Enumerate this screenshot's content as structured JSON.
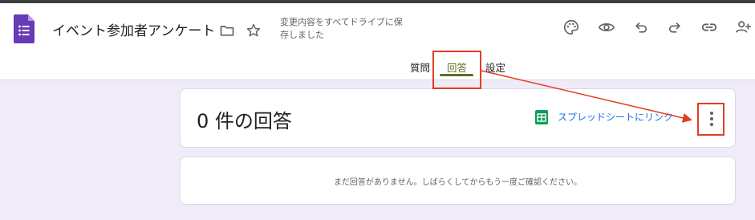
{
  "header": {
    "form_title": "イベント参加者アンケート",
    "save_status": "変更内容をすべてドライブに保存しました",
    "icons": [
      "forms-logo-icon",
      "folder-icon",
      "star-icon",
      "palette-icon",
      "eye-icon",
      "undo-icon",
      "redo-icon",
      "link-icon",
      "add-person-icon"
    ]
  },
  "tabs": [
    {
      "label": "質問",
      "active": false
    },
    {
      "label": "回答",
      "active": true
    },
    {
      "label": "設定",
      "active": false
    }
  ],
  "responses": {
    "count_text": "0 件の回答",
    "sheet_link_label": "スプレッドシートにリンク",
    "empty_message": "まだ回答がありません。しばらくしてからもう一度ご確認ください。"
  },
  "colors": {
    "accent_tab": "#5f6e24",
    "annotation": "#e53b22",
    "link": "#1a73e8",
    "forms_purple": "#673ab7",
    "sheets_green": "#0f9d58"
  }
}
